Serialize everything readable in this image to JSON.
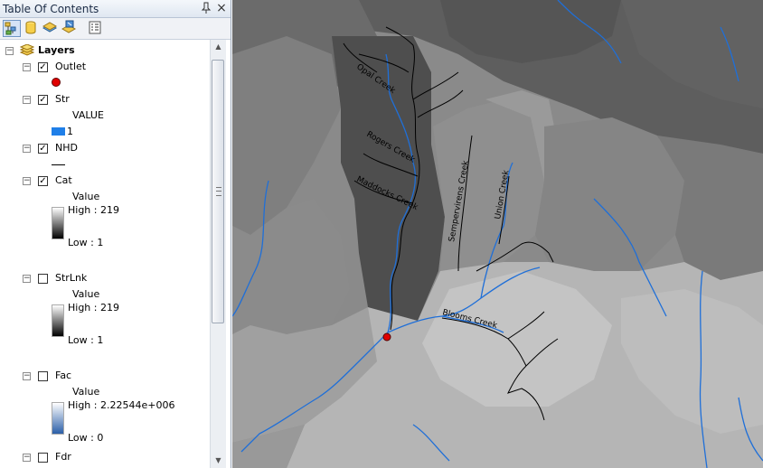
{
  "toc": {
    "title": "Table Of Contents",
    "pin_icon": "pin-icon",
    "close_label": "×",
    "toolbar_icons": [
      "list-by-drawing-order-icon",
      "list-by-source-icon",
      "list-by-visibility-icon",
      "list-by-selection-icon",
      "options-icon"
    ]
  },
  "layers_root": {
    "label": "Layers",
    "expanded": true
  },
  "layers": [
    {
      "name": "Outlet",
      "checked": true,
      "legend": {
        "type": "point",
        "color": "#e00000"
      }
    },
    {
      "name": "Str",
      "checked": true,
      "legend": {
        "type": "unique",
        "field": "VALUE",
        "items": [
          {
            "label": "1",
            "color": "#1f7fe8"
          }
        ]
      }
    },
    {
      "name": "NHD",
      "checked": true,
      "legend": {
        "type": "line",
        "color": "#000000"
      }
    },
    {
      "name": "Cat",
      "checked": true,
      "legend": {
        "type": "stretch",
        "field": "Value",
        "high": "High : 219",
        "low": "Low : 1",
        "ramp": [
          "#ffffff",
          "#000000"
        ]
      }
    },
    {
      "name": "StrLnk",
      "checked": false,
      "legend": {
        "type": "stretch",
        "field": "Value",
        "high": "High : 219",
        "low": "Low : 1",
        "ramp": [
          "#ffffff",
          "#000000"
        ]
      }
    },
    {
      "name": "Fac",
      "checked": false,
      "legend": {
        "type": "stretch",
        "field": "Value",
        "high": "High : 2.22544e+006",
        "low": "Low : 0",
        "ramp": [
          "#ffffff",
          "#2b5fa8"
        ]
      }
    },
    {
      "name": "Fdr",
      "checked": false
    }
  ],
  "map": {
    "creek_labels": [
      "Opal Creek",
      "Rogers Creek",
      "Maddocks Creek",
      "Sempervirens Creek",
      "Union Creek",
      "Blooms Creek"
    ],
    "colors": {
      "stream_blue": "#1f6fd8",
      "outlet_red": "#e00000",
      "nhd_black": "#000000"
    }
  }
}
